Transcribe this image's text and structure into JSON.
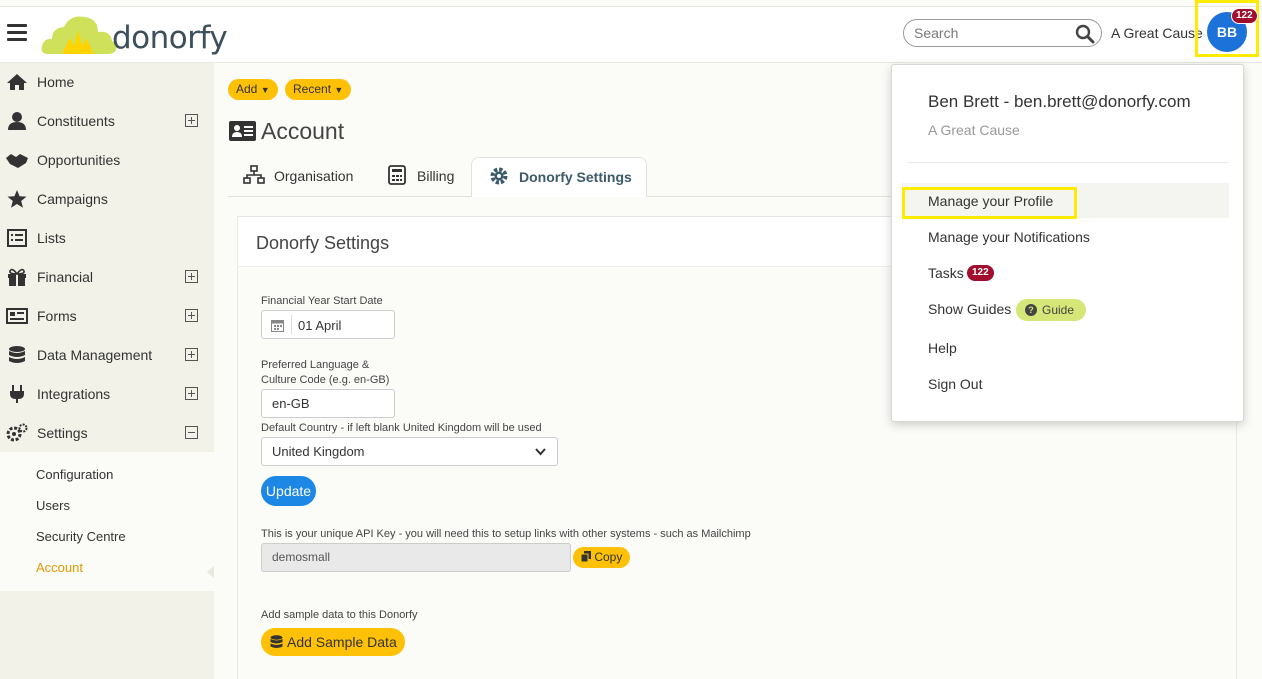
{
  "header": {
    "logo_text": "donorfy",
    "search_placeholder": "Search",
    "org_name": "A Great Cause",
    "avatar_initials": "BB",
    "notification_count": "122"
  },
  "sidebar": {
    "items": [
      {
        "label": "Home",
        "icon": "home-icon"
      },
      {
        "label": "Constituents",
        "icon": "user-icon"
      },
      {
        "label": "Opportunities",
        "icon": "handshake-icon"
      },
      {
        "label": "Campaigns",
        "icon": "star-icon"
      },
      {
        "label": "Lists",
        "icon": "list-icon"
      },
      {
        "label": "Financial",
        "icon": "gift-icon"
      },
      {
        "label": "Forms",
        "icon": "form-icon"
      },
      {
        "label": "Data Management",
        "icon": "database-icon"
      },
      {
        "label": "Integrations",
        "icon": "plug-icon"
      },
      {
        "label": "Settings",
        "icon": "gears-icon"
      }
    ],
    "settings_sub": [
      {
        "label": "Configuration"
      },
      {
        "label": "Users"
      },
      {
        "label": "Security Centre"
      },
      {
        "label": "Account",
        "active": true
      }
    ]
  },
  "toolbar": {
    "add_label": "Add",
    "recent_label": "Recent"
  },
  "page": {
    "title": "Account",
    "tabs": [
      {
        "label": "Organisation"
      },
      {
        "label": "Billing"
      },
      {
        "label": "Donorfy Settings",
        "active": true
      }
    ]
  },
  "settings_panel": {
    "title": "Donorfy Settings",
    "fy_label": "Financial Year Start Date",
    "fy_value": "01 April",
    "lang_label_1": "Preferred Language &",
    "lang_label_2": "Culture Code (e.g. en-GB)",
    "lang_value": "en-GB",
    "country_label": "Default Country - if left blank United Kingdom will be used",
    "country_value": "United Kingdom",
    "update_label": "Update",
    "api_label": "This is your unique API Key - you will need this to setup links with other systems - such as Mailchimp",
    "api_value": "demosmall",
    "copy_label": "Copy",
    "sample_label": "Add sample data to this Donorfy",
    "sample_button": "Add Sample Data"
  },
  "user_menu": {
    "name": "Ben Brett - ben.brett@donorfy.com",
    "org": "A Great Cause",
    "items": [
      {
        "label": "Manage your Profile"
      },
      {
        "label": "Manage your Notifications"
      },
      {
        "label": "Tasks"
      },
      {
        "label": "Show Guides"
      },
      {
        "label": "Help"
      },
      {
        "label": "Sign Out"
      }
    ],
    "tasks_count": "122",
    "guide_label": "Guide"
  },
  "colors": {
    "accent_yellow": "#ffc107",
    "primary_blue": "#1d87e5",
    "badge_red": "#a30d2d",
    "highlight": "#ffeb00",
    "active_orange": "#e09a00"
  }
}
